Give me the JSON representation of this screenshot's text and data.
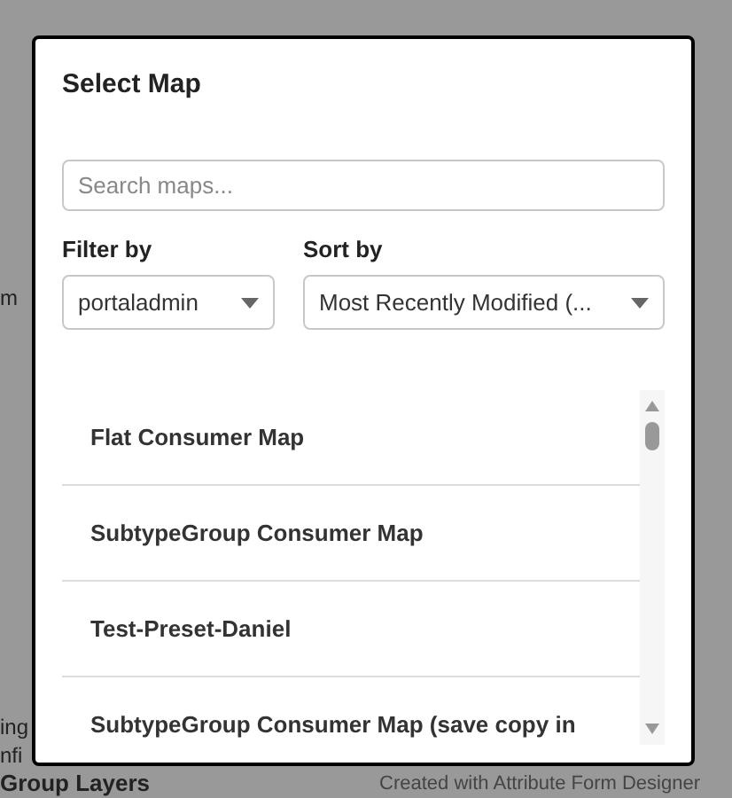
{
  "background": {
    "side_texts": [
      "m",
      "ing",
      "nfi"
    ],
    "heading": "Group Layers",
    "footer": "Created with Attribute Form Designer"
  },
  "dialog": {
    "title": "Select Map",
    "search": {
      "placeholder": "Search maps..."
    },
    "filter": {
      "label": "Filter by",
      "value": "portaladmin"
    },
    "sort": {
      "label": "Sort by",
      "value": "Most Recently Modified (..."
    },
    "maps": [
      {
        "name": "Flat Consumer Map"
      },
      {
        "name": "SubtypeGroup Consumer Map"
      },
      {
        "name": "Test-Preset-Daniel"
      },
      {
        "name": "SubtypeGroup Consumer Map (save copy in"
      }
    ]
  }
}
